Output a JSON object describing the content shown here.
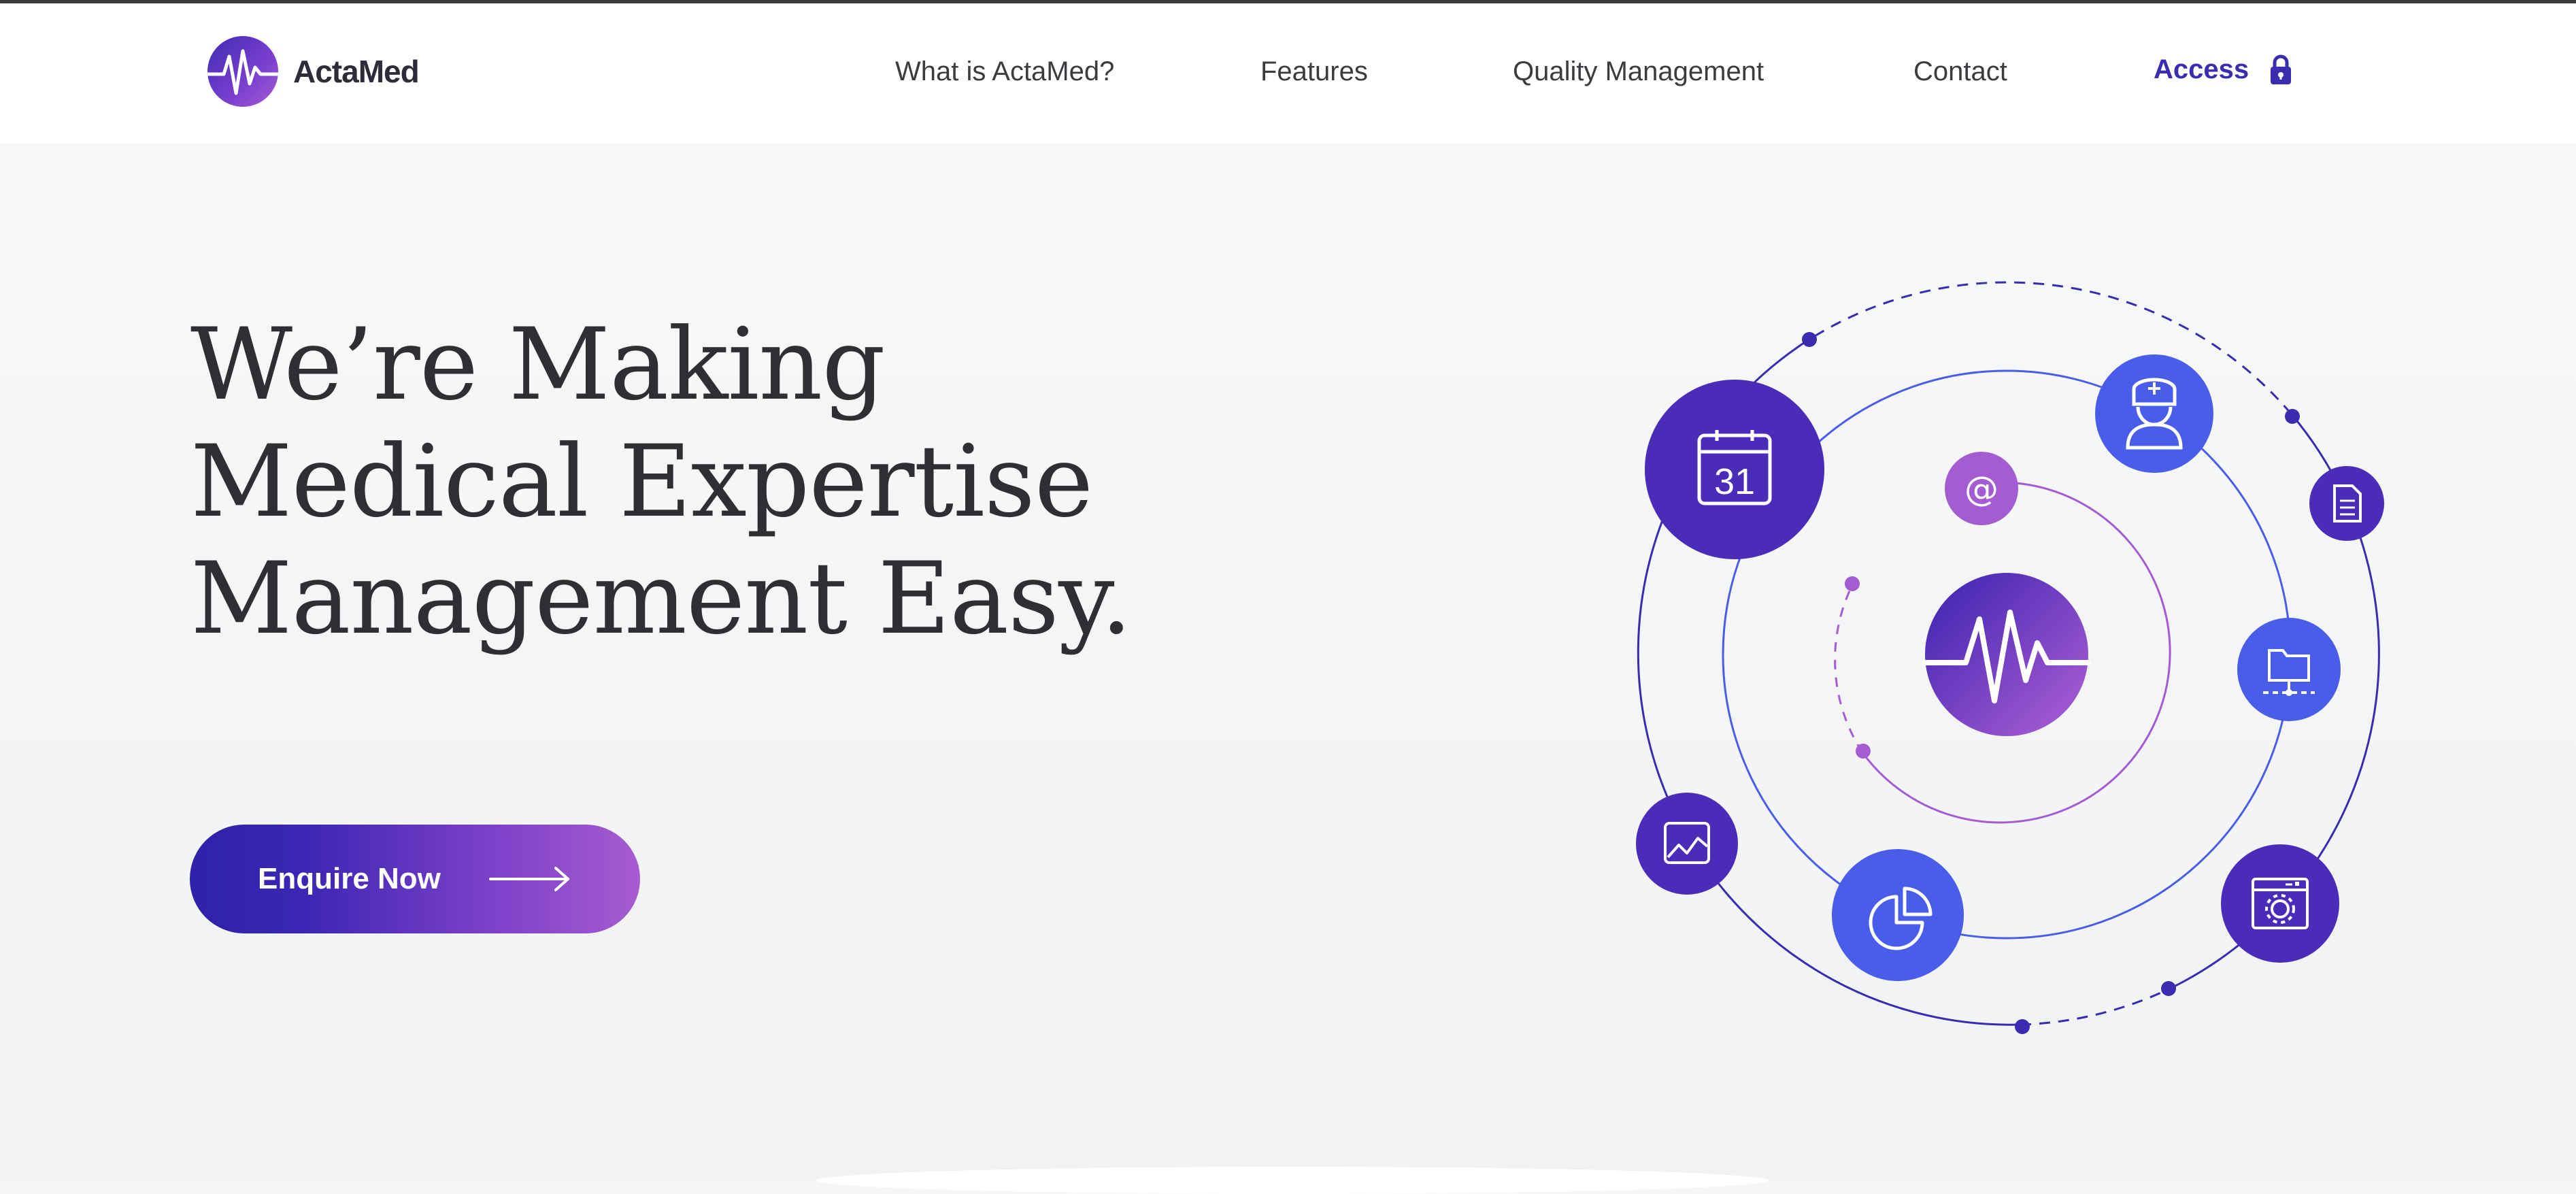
{
  "brand": {
    "name": "ActaMed",
    "accent": "#3a2db0",
    "gradient_start": "#2f22a8",
    "gradient_end": "#a75bd0"
  },
  "nav": {
    "items": [
      {
        "label": "What is ActaMed?"
      },
      {
        "label": "Features"
      },
      {
        "label": "Quality Management"
      },
      {
        "label": "Contact"
      }
    ],
    "access_label": "Access",
    "access_icon": "lock-icon"
  },
  "hero": {
    "headline": [
      "We’re Making",
      "Medical Expertise",
      "Management Easy."
    ],
    "cta_label": "Enquire Now",
    "cta_icon": "arrow-right-icon"
  },
  "illustration": {
    "center_icon": "heartbeat-logo-icon",
    "calendar_day": "31",
    "icons": [
      "calendar-icon",
      "at-sign-icon",
      "doctor-icon",
      "document-icon",
      "folder-network-icon",
      "settings-window-icon",
      "pie-chart-icon",
      "image-chart-icon"
    ]
  }
}
